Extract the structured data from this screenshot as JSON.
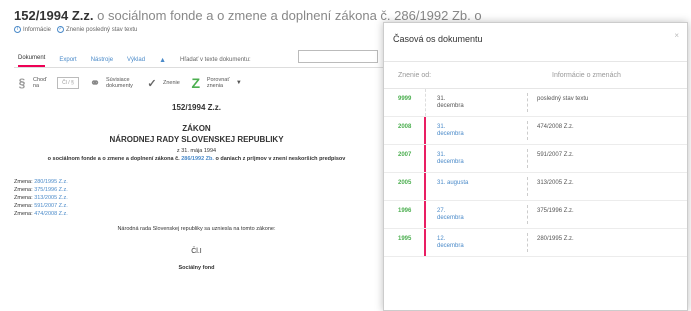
{
  "page": {
    "title_num": "152/1994 Z.z.",
    "title_rest": "o sociálnom fonde a o zmene a doplnení zákona č. 286/1992 Zb. o"
  },
  "top_links": {
    "info": "Informácie",
    "last_state": "Znenie posledný stav textu"
  },
  "tabs": [
    {
      "label": "Dokument"
    },
    {
      "label": "Export"
    },
    {
      "label": "Nástroje"
    },
    {
      "label": "Výklad"
    }
  ],
  "search": {
    "label": "Hľadať v texte dokumentu:"
  },
  "toolbar": {
    "chod_label": "Choď na",
    "cl_placeholder": "Čl / §",
    "related_label": "Súvisiace dokumenty",
    "version_label": "Znenie",
    "compare_label": "Porovnať znenia"
  },
  "document": {
    "number": "152/1994 Z.z.",
    "zakon": "ZÁKON",
    "rada": "NÁRODNEJ RADY SLOVENSKEJ REPUBLIKY",
    "date": "z 31. mája 1994",
    "about_pre": "o sociálnom fonde a o zmene a doplnení zákona č.",
    "about_link": "286/1992 Zb.",
    "about_post": "o daniach z príjmov v znení neskorších predpisov",
    "amendments": [
      {
        "prefix": "Zmena:",
        "ref": "280/1995 Z.z."
      },
      {
        "prefix": "Zmena:",
        "ref": "375/1996 Z.z."
      },
      {
        "prefix": "Zmena:",
        "ref": "313/2005 Z.z."
      },
      {
        "prefix": "Zmena:",
        "ref": "591/2007 Z.z."
      },
      {
        "prefix": "Zmena:",
        "ref": "474/2008 Z.z."
      }
    ],
    "passed": "Národná rada Slovenskej republiky sa uzniesla na tomto zákone:",
    "article": "Čl.I",
    "section": "Sociálny fond"
  },
  "modal": {
    "title": "Časová os dokumentu",
    "close": "×",
    "col_date": "Znenie od:",
    "col_info": "Informácie o zmenách",
    "rows": [
      {
        "year": "9999",
        "date_line1": "31.",
        "date_line2": "decembra",
        "info": "posledný stav textu"
      },
      {
        "year": "2008",
        "date_line1": "31.",
        "date_line2": "decembra",
        "info": "474/2008 Z.z."
      },
      {
        "year": "2007",
        "date_line1": "31.",
        "date_line2": "decembra",
        "info": "591/2007 Z.z."
      },
      {
        "year": "2005",
        "date_line1": "31. augusta",
        "date_line2": "",
        "info": "313/2005 Z.z."
      },
      {
        "year": "1996",
        "date_line1": "27.",
        "date_line2": "decembra",
        "info": "375/1996 Z.z."
      },
      {
        "year": "1995",
        "date_line1": "12.",
        "date_line2": "decembra",
        "info": "280/1995 Z.z."
      }
    ]
  },
  "colors": {
    "accent_blue": "#4a8ac9",
    "timeline_pink": "#e91e63",
    "year_green": "#4caf50"
  }
}
